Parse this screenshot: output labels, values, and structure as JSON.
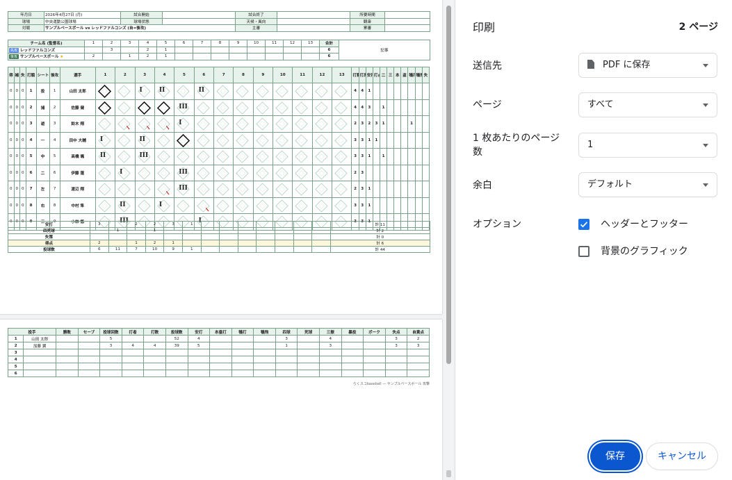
{
  "print": {
    "title": "印刷",
    "page_count": "2 ページ",
    "destination": {
      "label": "送信先",
      "value": "PDF に保存",
      "icon": "document-icon"
    },
    "pages": {
      "label": "ページ",
      "value": "すべて"
    },
    "pages_per_sheet": {
      "label": "1 枚あたりのページ数",
      "value": "1"
    },
    "margins": {
      "label": "余白",
      "value": "デフォルト"
    },
    "options": {
      "label": "オプション",
      "headers_footers": {
        "label": "ヘッダーとフッター",
        "checked": true
      },
      "background_graphics": {
        "label": "背景のグラフィック",
        "checked": false
      }
    },
    "save_label": "保存",
    "cancel_label": "キャンセル",
    "colors": {
      "accent": "#0b57d0",
      "checkbox": "#1a73e8"
    }
  },
  "sheet": {
    "info": [
      [
        "年月日",
        "2026年4月27日 (月)",
        "試合開始",
        "",
        "試合終了",
        "",
        "所要時間",
        ""
      ],
      [
        "球場",
        "中央運動公園球場",
        "球場状態",
        "",
        "天候・風向",
        "",
        "観衆",
        ""
      ],
      [
        "対戦",
        "サンプルベースボール vs レッドファルコンズ (自=後攻)",
        "",
        "",
        "主審",
        "",
        "累審",
        ""
      ]
    ],
    "score_header": {
      "team": "チーム名 (監督名)",
      "innings": [
        "1",
        "2",
        "3",
        "4",
        "5",
        "6",
        "7",
        "8",
        "9",
        "10",
        "11",
        "12",
        "13"
      ],
      "total": "合計",
      "notes": "記事"
    },
    "teams": [
      {
        "tag": "先攻",
        "name": "レッドファルコンズ",
        "star": "",
        "innings": [
          "",
          "3",
          "",
          "2",
          "1",
          "",
          "",
          "",
          "",
          "",
          "",
          "",
          ""
        ],
        "total": "6"
      },
      {
        "tag": "後攻",
        "name": "サンプルベースボール",
        "star": "★",
        "innings": [
          "2",
          "",
          "1",
          "2",
          "1",
          "",
          "",
          "",
          "",
          "",
          "",
          "",
          ""
        ],
        "total": "6"
      }
    ],
    "batting_header": [
      "得",
      "補",
      "失",
      "打順",
      "シート",
      "後攻",
      "選手",
      "1",
      "2",
      "3",
      "4",
      "5",
      "6",
      "7",
      "8",
      "9",
      "10",
      "11",
      "12",
      "13",
      "打数",
      "打席",
      "安打",
      "打点",
      "二",
      "三",
      "本",
      "盗",
      "犠打",
      "犠飛",
      "失"
    ],
    "batters": [
      {
        "order": "1",
        "pos": "投",
        "num": "1",
        "name": "山田 太郎",
        "stats": [
          "4",
          "4",
          "1",
          "",
          "",
          "",
          "",
          "",
          "",
          "",
          ""
        ]
      },
      {
        "order": "2",
        "pos": "捕",
        "num": "2",
        "name": "佐藤 健",
        "stats": [
          "4",
          "4",
          "3",
          "",
          "1",
          "",
          "",
          "",
          "",
          "",
          ""
        ]
      },
      {
        "order": "3",
        "pos": "遊",
        "num": "3",
        "name": "鈴木 翔",
        "stats": [
          "2",
          "3",
          "2",
          "3",
          "1",
          "",
          "",
          "",
          "1",
          "",
          ""
        ]
      },
      {
        "order": "4",
        "pos": "一",
        "num": "4",
        "name": "田中 大輔",
        "stats": [
          "3",
          "3",
          "1",
          "1",
          "",
          "",
          "",
          "",
          "",
          "",
          ""
        ]
      },
      {
        "order": "5",
        "pos": "中",
        "num": "5",
        "name": "高橋 颯",
        "stats": [
          "3",
          "3",
          "1",
          "",
          "1",
          "",
          "",
          "",
          "",
          "",
          ""
        ]
      },
      {
        "order": "6",
        "pos": "二",
        "num": "6",
        "name": "伊藤 蓮",
        "stats": [
          "2",
          "3",
          "",
          "",
          "",
          "",
          "",
          "",
          "",
          "",
          ""
        ]
      },
      {
        "order": "7",
        "pos": "左",
        "num": "7",
        "name": "渡辺 翔",
        "stats": [
          "2",
          "3",
          "1",
          "",
          "",
          "",
          "",
          "",
          "",
          "",
          ""
        ]
      },
      {
        "order": "8",
        "pos": "右",
        "num": "8",
        "name": "中村 隼",
        "stats": [
          "3",
          "3",
          "1",
          "",
          "",
          "",
          "",
          "",
          "",
          "",
          ""
        ]
      },
      {
        "order": "9",
        "pos": "三",
        "num": "9",
        "name": "小林 悠",
        "stats": [
          "3",
          "3",
          "1",
          "",
          "",
          "",
          "",
          "",
          "",
          "",
          ""
        ]
      }
    ],
    "totals": [
      {
        "label": "安打",
        "values": [
          "3",
          "",
          "2",
          "2",
          "3",
          "1"
        ],
        "total": "計 11"
      },
      {
        "label": "四死球",
        "values": [
          "",
          "1",
          "",
          "1",
          "",
          ""
        ],
        "total": "計 2"
      },
      {
        "label": "失策",
        "values": [
          "",
          "",
          "",
          "",
          "",
          ""
        ],
        "total": "計 0"
      },
      {
        "label": "得点",
        "values": [
          "2",
          "",
          "1",
          "2",
          "1",
          ""
        ],
        "total": "計 6"
      },
      {
        "label": "投球数",
        "values": [
          "6",
          "11",
          "7",
          "10",
          "9",
          "1"
        ],
        "total": "計 44"
      }
    ],
    "pitching_header": [
      "投手",
      "",
      "勝敗",
      "セーブ",
      "投球回数",
      "打者",
      "打数",
      "投球数",
      "安打",
      "本塁打",
      "犠打",
      "犠飛",
      "四球",
      "死球",
      "三振",
      "暴投",
      "ボーク",
      "失点",
      "自責点"
    ],
    "pitchers": [
      [
        "1",
        "山田 太郎",
        "",
        "",
        "5",
        "",
        "",
        "52",
        "4",
        "",
        "",
        "",
        "3",
        "",
        "4",
        "",
        "",
        "3",
        "2"
      ],
      [
        "2",
        "加藤 翼",
        "",
        "",
        "3",
        "4",
        "4",
        "39",
        "5",
        "",
        "",
        "",
        "1",
        "",
        "3",
        "",
        "",
        "3",
        "3"
      ],
      [
        "3",
        "",
        "",
        "",
        "",
        "",
        "",
        "",
        "",
        "",
        "",
        "",
        "",
        "",
        "",
        "",
        "",
        "",
        ""
      ],
      [
        "4",
        "",
        "",
        "",
        "",
        "",
        "",
        "",
        "",
        "",
        "",
        "",
        "",
        "",
        "",
        "",
        "",
        "",
        ""
      ],
      [
        "5",
        "",
        "",
        "",
        "",
        "",
        "",
        "",
        "",
        "",
        "",
        "",
        "",
        "",
        "",
        "",
        "",
        "",
        ""
      ],
      [
        "6",
        "",
        "",
        "",
        "",
        "",
        "",
        "",
        "",
        "",
        "",
        "",
        "",
        "",
        "",
        "",
        "",
        "",
        ""
      ]
    ],
    "footnote": "らくスコbaseball — サンプルベースボール 攻撃"
  }
}
